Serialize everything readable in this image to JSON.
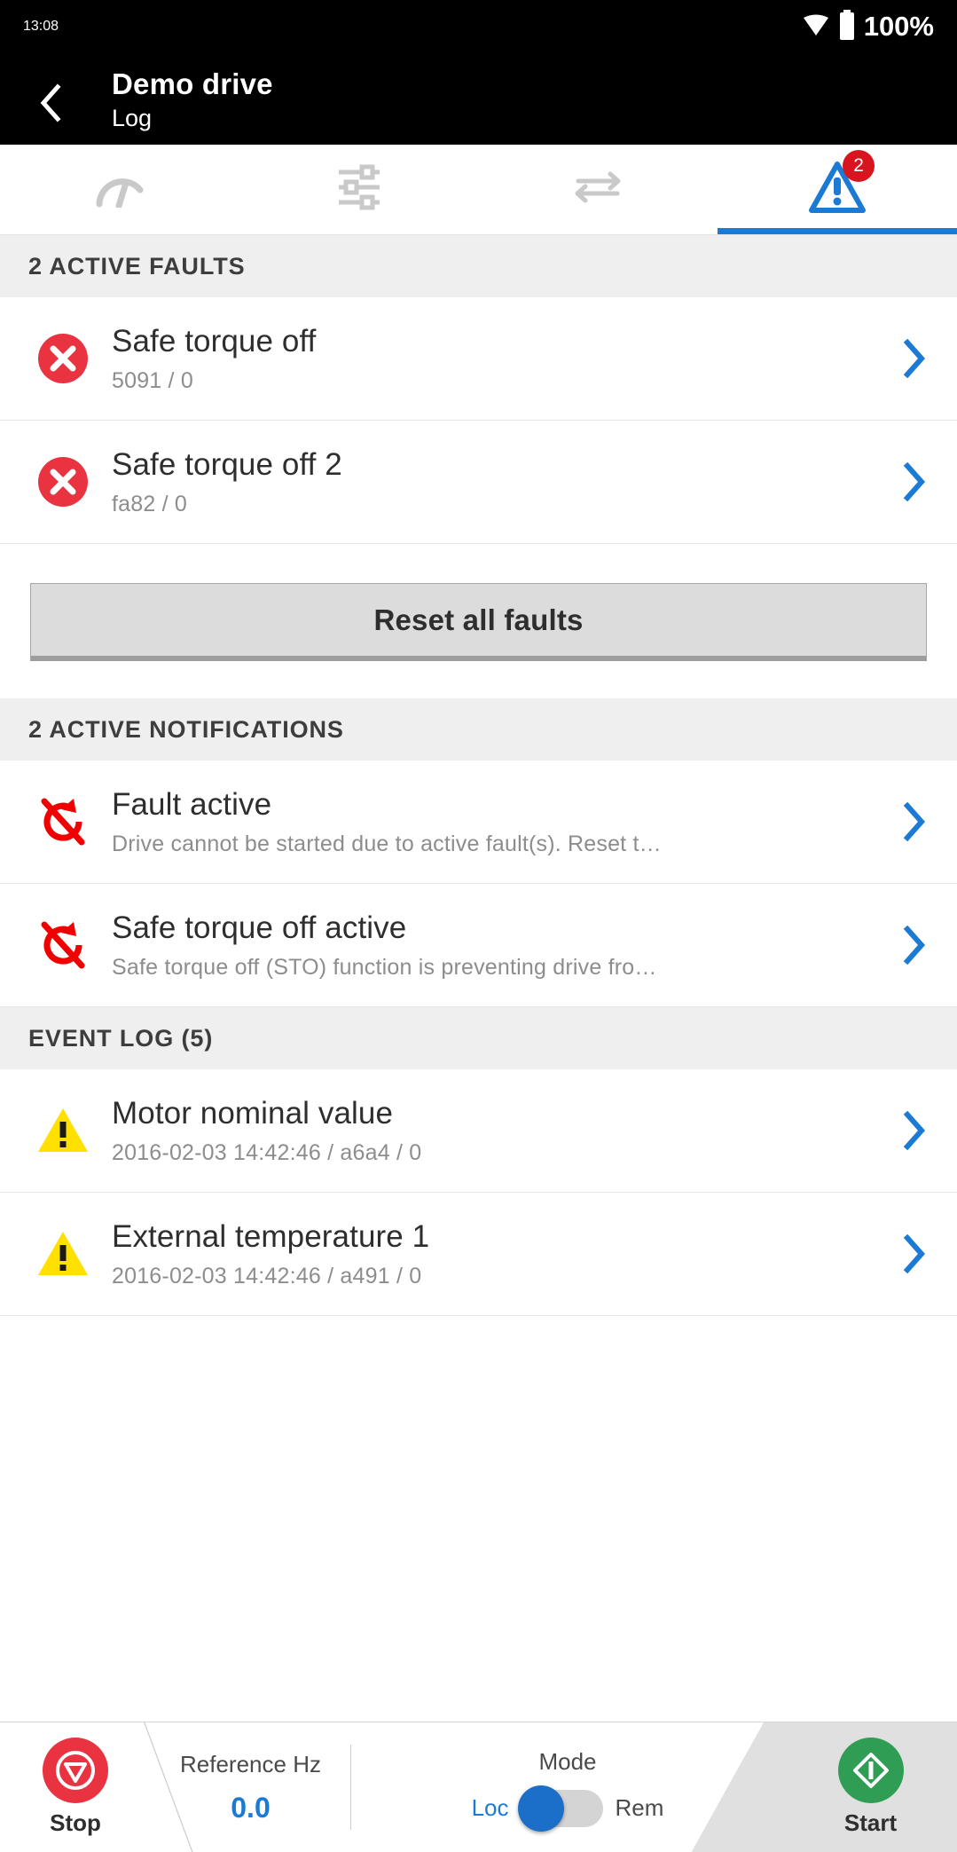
{
  "status_bar": {
    "time": "13:08",
    "battery_percent": "100%",
    "wifi_icon": "wifi-icon",
    "battery_icon": "battery-full-icon"
  },
  "app_bar": {
    "back_icon": "back-chevron-icon",
    "title": "Demo drive",
    "subtitle": "Log"
  },
  "tabs": [
    {
      "name": "tab-dashboard",
      "icon": "gauge-icon",
      "active": false,
      "badge": ""
    },
    {
      "name": "tab-parameters",
      "icon": "sliders-icon",
      "active": false,
      "badge": ""
    },
    {
      "name": "tab-io",
      "icon": "transfer-arrows-icon",
      "active": false,
      "badge": ""
    },
    {
      "name": "tab-faults",
      "icon": "warning-triangle-icon",
      "active": true,
      "badge": "2"
    }
  ],
  "sections": {
    "faults_header": "2 ACTIVE FAULTS",
    "notifications_header": "2 ACTIVE NOTIFICATIONS",
    "event_log_header": "EVENT LOG (5)"
  },
  "faults": [
    {
      "icon": "error-circle-icon",
      "title": "Safe torque off",
      "meta": "5091 / 0"
    },
    {
      "icon": "error-circle-icon",
      "title": "Safe torque off 2",
      "meta": "fa82 / 0"
    }
  ],
  "reset_button": {
    "label": "Reset all faults"
  },
  "notifications": [
    {
      "icon": "no-rotation-icon",
      "title": "Fault active",
      "meta": "Drive cannot be started due to active fault(s). Reset t…"
    },
    {
      "icon": "no-rotation-icon",
      "title": "Safe torque off active",
      "meta": "Safe torque off (STO) function is preventing drive fro…"
    }
  ],
  "events": [
    {
      "icon": "warning-triangle-yellow-icon",
      "title": "Motor nominal value",
      "meta": "2016-02-03 14:42:46 / a6a4 / 0"
    },
    {
      "icon": "warning-triangle-yellow-icon",
      "title": "External temperature 1",
      "meta": "2016-02-03 14:42:46 / a491 / 0"
    }
  ],
  "chevron_icon": "chevron-right-icon",
  "bottom_bar": {
    "stop": {
      "label": "Stop",
      "icon": "stop-triangle-icon"
    },
    "reference": {
      "caption": "Reference Hz",
      "value": "0.0"
    },
    "mode": {
      "caption": "Mode",
      "left_label": "Loc",
      "right_label": "Rem",
      "selected": "Loc"
    },
    "start": {
      "label": "Start",
      "icon": "start-diamond-icon"
    }
  },
  "colors": {
    "accent_blue": "#1b7ad4",
    "fault_red": "#ea3340",
    "notification_red": "#f00000",
    "warning_yellow": "#ffe000",
    "start_green": "#2f9e54",
    "badge_red": "#d8141e"
  }
}
